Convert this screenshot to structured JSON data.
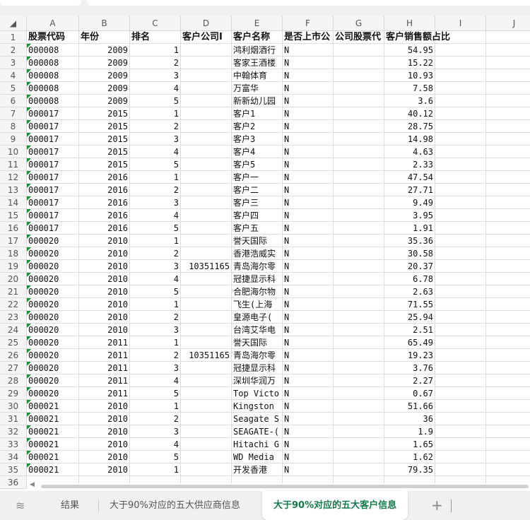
{
  "columns": [
    "A",
    "B",
    "C",
    "D",
    "E",
    "F",
    "G",
    "H",
    "I",
    "J"
  ],
  "header": [
    "股票代码",
    "年份",
    "排名",
    "客户公司I",
    "客户名称",
    "是否上市公",
    "公司股票代",
    "客户销售额占比",
    "",
    ""
  ],
  "rows": [
    [
      "000008",
      "2009",
      "1",
      "",
      "鸿利烟酒行",
      "N",
      "",
      "54.95"
    ],
    [
      "000008",
      "2009",
      "2",
      "",
      "客家王酒楼",
      "N",
      "",
      "15.22"
    ],
    [
      "000008",
      "2009",
      "3",
      "",
      "中翰体育",
      "N",
      "",
      "10.93"
    ],
    [
      "000008",
      "2009",
      "4",
      "",
      "万富华",
      "N",
      "",
      "7.58"
    ],
    [
      "000008",
      "2009",
      "5",
      "",
      "新新幼儿园",
      "N",
      "",
      "3.6"
    ],
    [
      "000017",
      "2015",
      "1",
      "",
      "客户1",
      "N",
      "",
      "40.12"
    ],
    [
      "000017",
      "2015",
      "2",
      "",
      "客户2",
      "N",
      "",
      "28.75"
    ],
    [
      "000017",
      "2015",
      "3",
      "",
      "客户3",
      "N",
      "",
      "14.98"
    ],
    [
      "000017",
      "2015",
      "4",
      "",
      "客户4",
      "N",
      "",
      "4.63"
    ],
    [
      "000017",
      "2015",
      "5",
      "",
      "客户5",
      "N",
      "",
      "2.33"
    ],
    [
      "000017",
      "2016",
      "1",
      "",
      "客户一",
      "N",
      "",
      "47.54"
    ],
    [
      "000017",
      "2016",
      "2",
      "",
      "客户二",
      "N",
      "",
      "27.71"
    ],
    [
      "000017",
      "2016",
      "3",
      "",
      "客户三",
      "N",
      "",
      "9.49"
    ],
    [
      "000017",
      "2016",
      "4",
      "",
      "客户四",
      "N",
      "",
      "3.95"
    ],
    [
      "000017",
      "2016",
      "5",
      "",
      "客户五",
      "N",
      "",
      "1.91"
    ],
    [
      "000020",
      "2010",
      "1",
      "",
      "誉天国际",
      "N",
      "",
      "35.36"
    ],
    [
      "000020",
      "2010",
      "2",
      "",
      "香港浩威实",
      "N",
      "",
      "30.58"
    ],
    [
      "000020",
      "2010",
      "3",
      "10351165",
      "青岛海尔零",
      "N",
      "",
      "20.37"
    ],
    [
      "000020",
      "2010",
      "4",
      "",
      "冠捷显示科",
      "N",
      "",
      "6.78"
    ],
    [
      "000020",
      "2010",
      "5",
      "",
      "合肥海尔物",
      "N",
      "",
      "2.63"
    ],
    [
      "000020",
      "2010",
      "1",
      "",
      "飞生(上海",
      "N",
      "",
      "71.55"
    ],
    [
      "000020",
      "2010",
      "2",
      "",
      "皇源电子(",
      "N",
      "",
      "25.94"
    ],
    [
      "000020",
      "2010",
      "3",
      "",
      "台湾艾华电",
      "N",
      "",
      "2.51"
    ],
    [
      "000020",
      "2011",
      "1",
      "",
      "誉天国际",
      "N",
      "",
      "65.49"
    ],
    [
      "000020",
      "2011",
      "2",
      "10351165",
      "青岛海尔零",
      "N",
      "",
      "19.23"
    ],
    [
      "000020",
      "2011",
      "3",
      "",
      "冠捷显示科",
      "N",
      "",
      "3.76"
    ],
    [
      "000020",
      "2011",
      "4",
      "",
      "深圳华润万",
      "N",
      "",
      "2.27"
    ],
    [
      "000020",
      "2011",
      "5",
      "",
      "Top Victo",
      "N",
      "",
      "0.67"
    ],
    [
      "000021",
      "2010",
      "1",
      "",
      "Kingston",
      "N",
      "",
      "51.66"
    ],
    [
      "000021",
      "2010",
      "2",
      "",
      "Seagate S",
      "N",
      "",
      "36"
    ],
    [
      "000021",
      "2010",
      "3",
      "",
      "SEAGATE-(",
      "N",
      "",
      "1.9"
    ],
    [
      "000021",
      "2010",
      "4",
      "",
      "Hitachi G",
      "N",
      "",
      "1.65"
    ],
    [
      "000021",
      "2010",
      "5",
      "",
      "WD Media",
      "N",
      "",
      "1.62"
    ],
    [
      "000021",
      "2010",
      "1",
      "",
      "开发香港",
      "N",
      "",
      "79.35"
    ]
  ],
  "tabs": {
    "result": "结果",
    "supplier": "大于90%对应的五大供应商信息",
    "customer": "大于90%对应的五大客户信息",
    "add": "+"
  },
  "colors": {
    "accent": "#137a4a",
    "marker": "#1a8f3a"
  }
}
